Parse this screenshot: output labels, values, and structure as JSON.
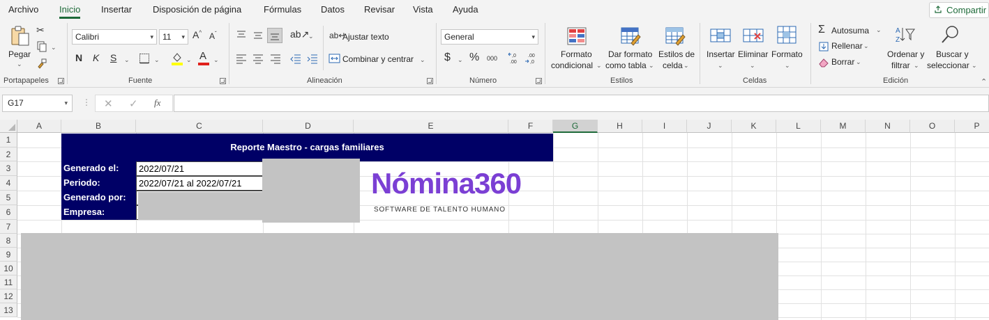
{
  "tabs": [
    "Archivo",
    "Inicio",
    "Insertar",
    "Disposición de página",
    "Fórmulas",
    "Datos",
    "Revisar",
    "Vista",
    "Ayuda"
  ],
  "active_tab": "Inicio",
  "share_label": "Compartir",
  "clipboard": {
    "paste_label": "Pegar",
    "group_label": "Portapapeles"
  },
  "font": {
    "name": "Calibri",
    "size": "11",
    "group_label": "Fuente",
    "bold": "N",
    "italic": "K",
    "underline": "S"
  },
  "alignment": {
    "wrap_label": "Ajustar texto",
    "merge_label": "Combinar y centrar",
    "group_label": "Alineación"
  },
  "number": {
    "format": "General",
    "group_label": "Número",
    "currency": "$",
    "percent": "%",
    "thousands": "000",
    "inc_decimals": "←,0\n.00",
    "dec_decimals": ".00\n→,0"
  },
  "styles": {
    "conditional_line1": "Formato",
    "conditional_line2": "condicional",
    "table_line1": "Dar formato",
    "table_line2": "como tabla",
    "cell_line1": "Estilos de",
    "cell_line2": "celda",
    "group_label": "Estilos"
  },
  "cells": {
    "insert_label": "Insertar",
    "delete_label": "Eliminar",
    "format_label": "Formato",
    "group_label": "Celdas"
  },
  "editing": {
    "autosum_label": "Autosuma",
    "fill_label": "Rellenar",
    "clear_label": "Borrar",
    "sort_line1": "Ordenar y",
    "sort_line2": "filtrar",
    "find_line1": "Buscar y",
    "find_line2": "seleccionar",
    "group_label": "Edición"
  },
  "formula_bar": {
    "name_box": "G17",
    "fx": "fx",
    "formula": ""
  },
  "columns": [
    "A",
    "B",
    "C",
    "D",
    "E",
    "F",
    "G",
    "H",
    "I",
    "J",
    "K",
    "L",
    "M",
    "N",
    "O",
    "P"
  ],
  "selected_column": "G",
  "rows": [
    "1",
    "2",
    "3",
    "4",
    "5",
    "6",
    "7",
    "8",
    "9",
    "10",
    "11",
    "12",
    "13"
  ],
  "sheet": {
    "banner_title": "Reporte Maestro - cargas familiares",
    "labels": [
      "Generado el:",
      "Periodo:",
      "Generado por:",
      "Empresa:"
    ],
    "values": [
      "2022/07/21",
      "2022/07/21 al 2022/07/21",
      "",
      ""
    ],
    "logo_text": "Nómina360",
    "logo_tagline": "SOFTWARE DE TALENTO HUMANO"
  },
  "colors": {
    "banner_bg": "#000066",
    "logo_purple": "#7b3fd4",
    "accent_green": "#1e6a39",
    "redaction_gray": "#c3c3c3"
  }
}
